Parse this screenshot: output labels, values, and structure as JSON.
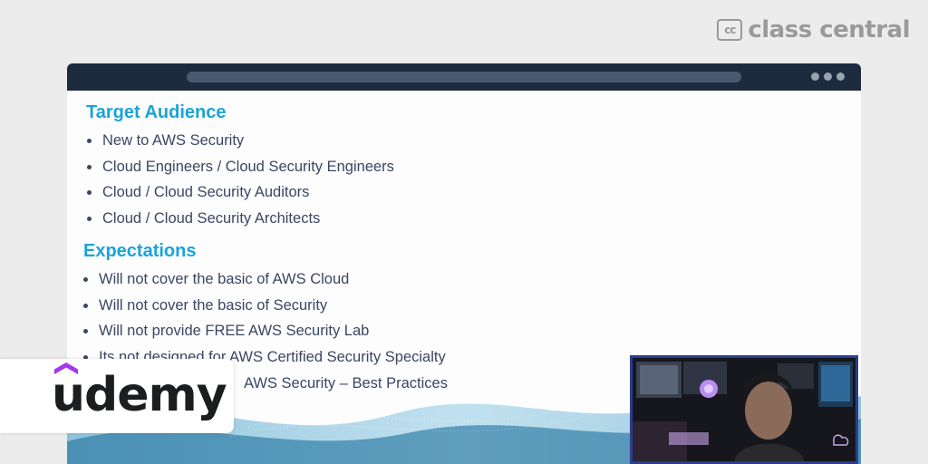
{
  "brand": {
    "class_central_icon": "cc",
    "class_central_name": "class central",
    "udemy_name": "udemy"
  },
  "slide": {
    "target_audience": {
      "title": "Target Audience",
      "items": [
        "New to AWS Security",
        "Cloud Engineers / Cloud Security Engineers",
        "Cloud  / Cloud Security Auditors",
        "Cloud / Cloud Security Architects"
      ]
    },
    "expectations": {
      "title": "Expectations",
      "items": [
        "Will not cover the basic of AWS Cloud",
        "Will not cover the basic of Security",
        "Will not provide FREE AWS Security Lab",
        "Its not designed for AWS Certified Security Specialty",
        "AWS Security – Best Practices"
      ]
    }
  },
  "colors": {
    "heading": "#1aa3d9",
    "body_text": "#3b4662",
    "browser_bar": "#1d2b3f",
    "udemy_purple": "#a435f0",
    "webcam_border": "#2a3d8f"
  },
  "icons": [
    "class-central-cc-icon",
    "udemy-hat-icon",
    "window-dots-icon"
  ]
}
